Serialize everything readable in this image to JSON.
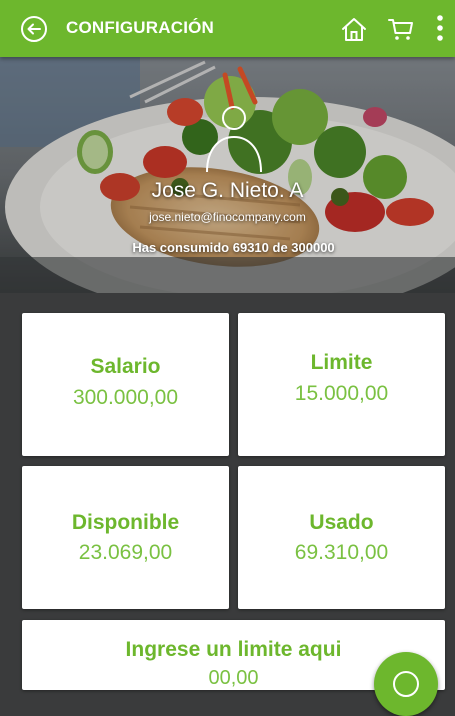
{
  "header": {
    "title": "CONFIGURACIÓN",
    "back_icon": "arrow-left-circle-icon",
    "home_icon": "home-icon",
    "cart_icon": "cart-icon",
    "more_icon": "more-vertical-icon"
  },
  "profile": {
    "avatar_icon": "user-avatar-icon",
    "name": "Jose G. Nieto. A",
    "email": "jose.nieto@finocompany.com",
    "usage": "Has consumido 69310 de 300000"
  },
  "cards": [
    {
      "label": "Salario",
      "value": "300.000,00"
    },
    {
      "label": "Limite",
      "value": "15.000,00"
    },
    {
      "label": "Disponible",
      "value": "23.069,00"
    },
    {
      "label": "Usado",
      "value": "69.310,00"
    }
  ],
  "limit_input": {
    "label": "Ingrese un limite aqui",
    "placeholder": "00,00"
  },
  "fab": {
    "icon": "circle-action-icon"
  },
  "colors": {
    "brand_green": "#6db72d",
    "value_green": "#7ac142",
    "background": "#3a3b3c",
    "card": "#ffffff"
  }
}
